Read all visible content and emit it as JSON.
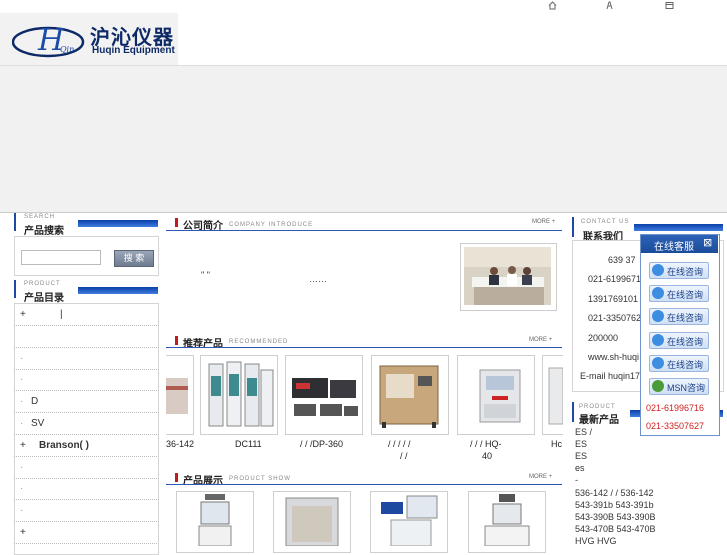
{
  "header": {
    "logo_cn": "沪沁仪器",
    "logo_en": "Huqin Equipment",
    "logo_script": "Qin"
  },
  "search": {
    "title_en": "SEARCH",
    "title_cn": "产品搜索",
    "button": "搜 索",
    "placeholder": ""
  },
  "catalog": {
    "title_en": "PRODUCT",
    "title_cn": "产品目录",
    "items": [
      {
        "bullet": "+",
        "label": "|"
      },
      {
        "bullet": "",
        "label": ""
      },
      {
        "bullet": "·",
        "label": ""
      },
      {
        "bullet": "·",
        "label": ""
      },
      {
        "bullet": "·",
        "label": "D"
      },
      {
        "bullet": "·",
        "label": "SV"
      },
      {
        "bullet": "+",
        "label": "Branson(     )"
      },
      {
        "bullet": "·",
        "label": ""
      },
      {
        "bullet": "·",
        "label": ""
      },
      {
        "bullet": "·",
        "label": ""
      },
      {
        "bullet": "+",
        "label": ""
      }
    ]
  },
  "company": {
    "title_cn": "公司简介",
    "title_en": "COMPANY INTRODUCE",
    "more": "MORE +",
    "quote": "\"     \"",
    "ellipsis": "……"
  },
  "recommended": {
    "title_cn": "推荐产品",
    "title_en": "RECOMMENDED",
    "more": "MORE +",
    "captions": [
      "36-142",
      "DC111",
      "/  /  /DP-360",
      "/   /   /   /   /",
      "/   /   /   HQ-",
      "Hc"
    ],
    "captions2": [
      "",
      "",
      "",
      "/   /",
      "40",
      ""
    ]
  },
  "showcase": {
    "title_cn": "产品展示",
    "title_en": "PRODUCT SHOW",
    "more": "MORE +"
  },
  "contact": {
    "title_en": "CONTACT US",
    "title_cn": "联系我们",
    "lines": [
      "639 37",
      "021-6199671",
      "1391769101",
      "021-3350762",
      "200000",
      "www.sh-huqi",
      "E-mail huqin17"
    ]
  },
  "latest": {
    "title_en": "PRODUCT",
    "title_cn": "最新产品",
    "lines": [
      "ES   /",
      "ES",
      "ES",
      "es",
      "-",
      "536-142   /  /  536-142",
      "543-391b     543-391b",
      "543-390B     543-390B",
      "543-470B     543-470B",
      "HVG   HVG"
    ]
  },
  "kefu": {
    "title": "在线客服",
    "close": "⊠",
    "buttons": [
      "在线咨询",
      "在线咨询",
      "在线咨询",
      "在线咨询",
      "在线咨询",
      "MSN咨询"
    ],
    "phones": [
      "021-61996716",
      "021-33507627"
    ]
  },
  "icons": [
    "home-icon",
    "sitemap-icon",
    "bookmark-icon"
  ]
}
